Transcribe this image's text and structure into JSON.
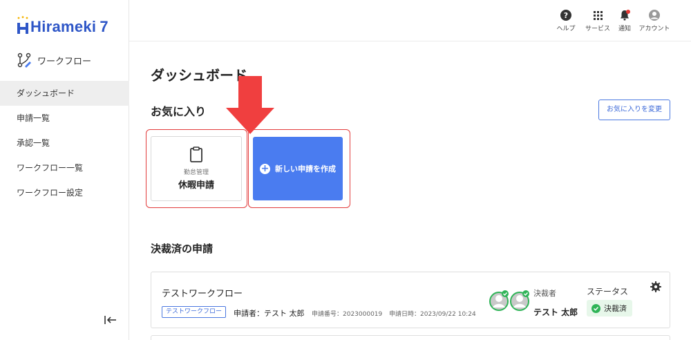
{
  "brand": {
    "name": "Hirameki",
    "version": "7",
    "logo_letter": "H"
  },
  "sidebar": {
    "section_title": "ワークフロー",
    "items": [
      {
        "label": "ダッシュボード",
        "active": true
      },
      {
        "label": "申請一覧",
        "active": false
      },
      {
        "label": "承認一覧",
        "active": false
      },
      {
        "label": "ワークフロー一覧",
        "active": false
      },
      {
        "label": "ワークフロー設定",
        "active": false
      }
    ],
    "collapse_icon": "collapse-left-icon"
  },
  "header": {
    "icons": [
      {
        "label": "ヘルプ",
        "icon": "help-icon"
      },
      {
        "label": "サービス",
        "icon": "grid-icon"
      },
      {
        "label": "通知",
        "icon": "bell-icon"
      },
      {
        "label": "アカウント",
        "icon": "account-icon"
      }
    ]
  },
  "main": {
    "page_title": "ダッシュボード",
    "favorites": {
      "title": "お気に入り",
      "change_button": "お気に入りを変更",
      "leave_card": {
        "category": "勤怠管理",
        "name": "休暇申請",
        "icon": "clipboard-icon"
      },
      "new_card": {
        "label": "新しい申請を作成",
        "icon": "plus-circle-icon"
      }
    },
    "completed": {
      "title": "決裁済の申請",
      "request": {
        "workflow_name": "テストワークフロー",
        "tag": "テストワークフロー",
        "applicant": "申請者：テスト 太郎",
        "request_number": "申請番号：2023000019",
        "request_datetime": "申請日時：2023/09/22 10:24",
        "approver_label": "決裁者",
        "approver_name": "テスト 太郎",
        "status_label": "ステータス",
        "status_value": "決裁済"
      }
    }
  },
  "colors": {
    "brand_blue": "#2e56c7",
    "primary": "#4a7cf0",
    "highlight_red": "#e23b3b",
    "status_green": "#2fb457",
    "status_bg": "#e7f7ea"
  }
}
